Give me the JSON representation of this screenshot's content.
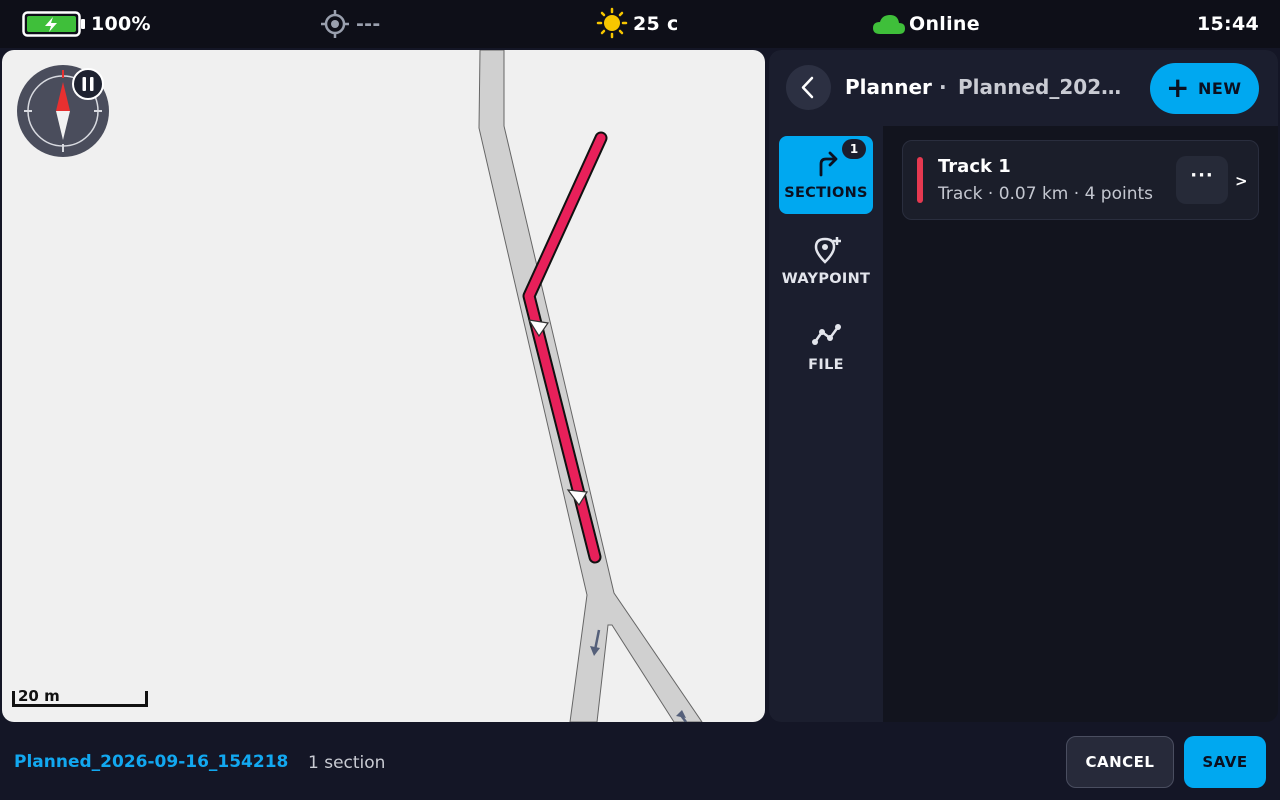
{
  "status_bar": {
    "battery": "100%",
    "gps": "---",
    "temperature": "25 c",
    "connection": "Online",
    "time": "15:44",
    "icons": [
      "battery-icon",
      "gps-target-icon",
      "sun-icon",
      "cloud-icon"
    ],
    "colors": {
      "battery": "#3fbf3a",
      "sun": "#f7c600",
      "cloud": "#3fbf3a"
    }
  },
  "map": {
    "scale_label": "20 m",
    "icons": [
      "compass-icon",
      "pause-icon"
    ],
    "track_color": "#e8205a"
  },
  "planner": {
    "title": "Planner",
    "separator": "·",
    "plan_name": "Planned_2026-09-16_154218",
    "new_button": {
      "icon": "+",
      "label": "NEW"
    },
    "rail": [
      {
        "label": "SECTIONS",
        "icon": "turn-right-arrow-icon",
        "badge": "1",
        "active": true
      },
      {
        "label": "WAYPOINT",
        "icon": "add-location-pin-icon",
        "active": false
      },
      {
        "label": "FILE",
        "icon": "route-file-icon",
        "active": false
      }
    ],
    "tracks": [
      {
        "name": "Track 1",
        "meta": "Track · 0.07 km · 4 points",
        "color": "#e53950",
        "more": "···",
        "chevron": ">"
      }
    ]
  },
  "footer": {
    "plan_name": "Planned_2026-09-16_154218",
    "section_count": "1 section",
    "cancel_label": "CANCEL",
    "save_label": "SAVE"
  },
  "colors": {
    "accent": "#00a8f0",
    "background": "#141626"
  }
}
